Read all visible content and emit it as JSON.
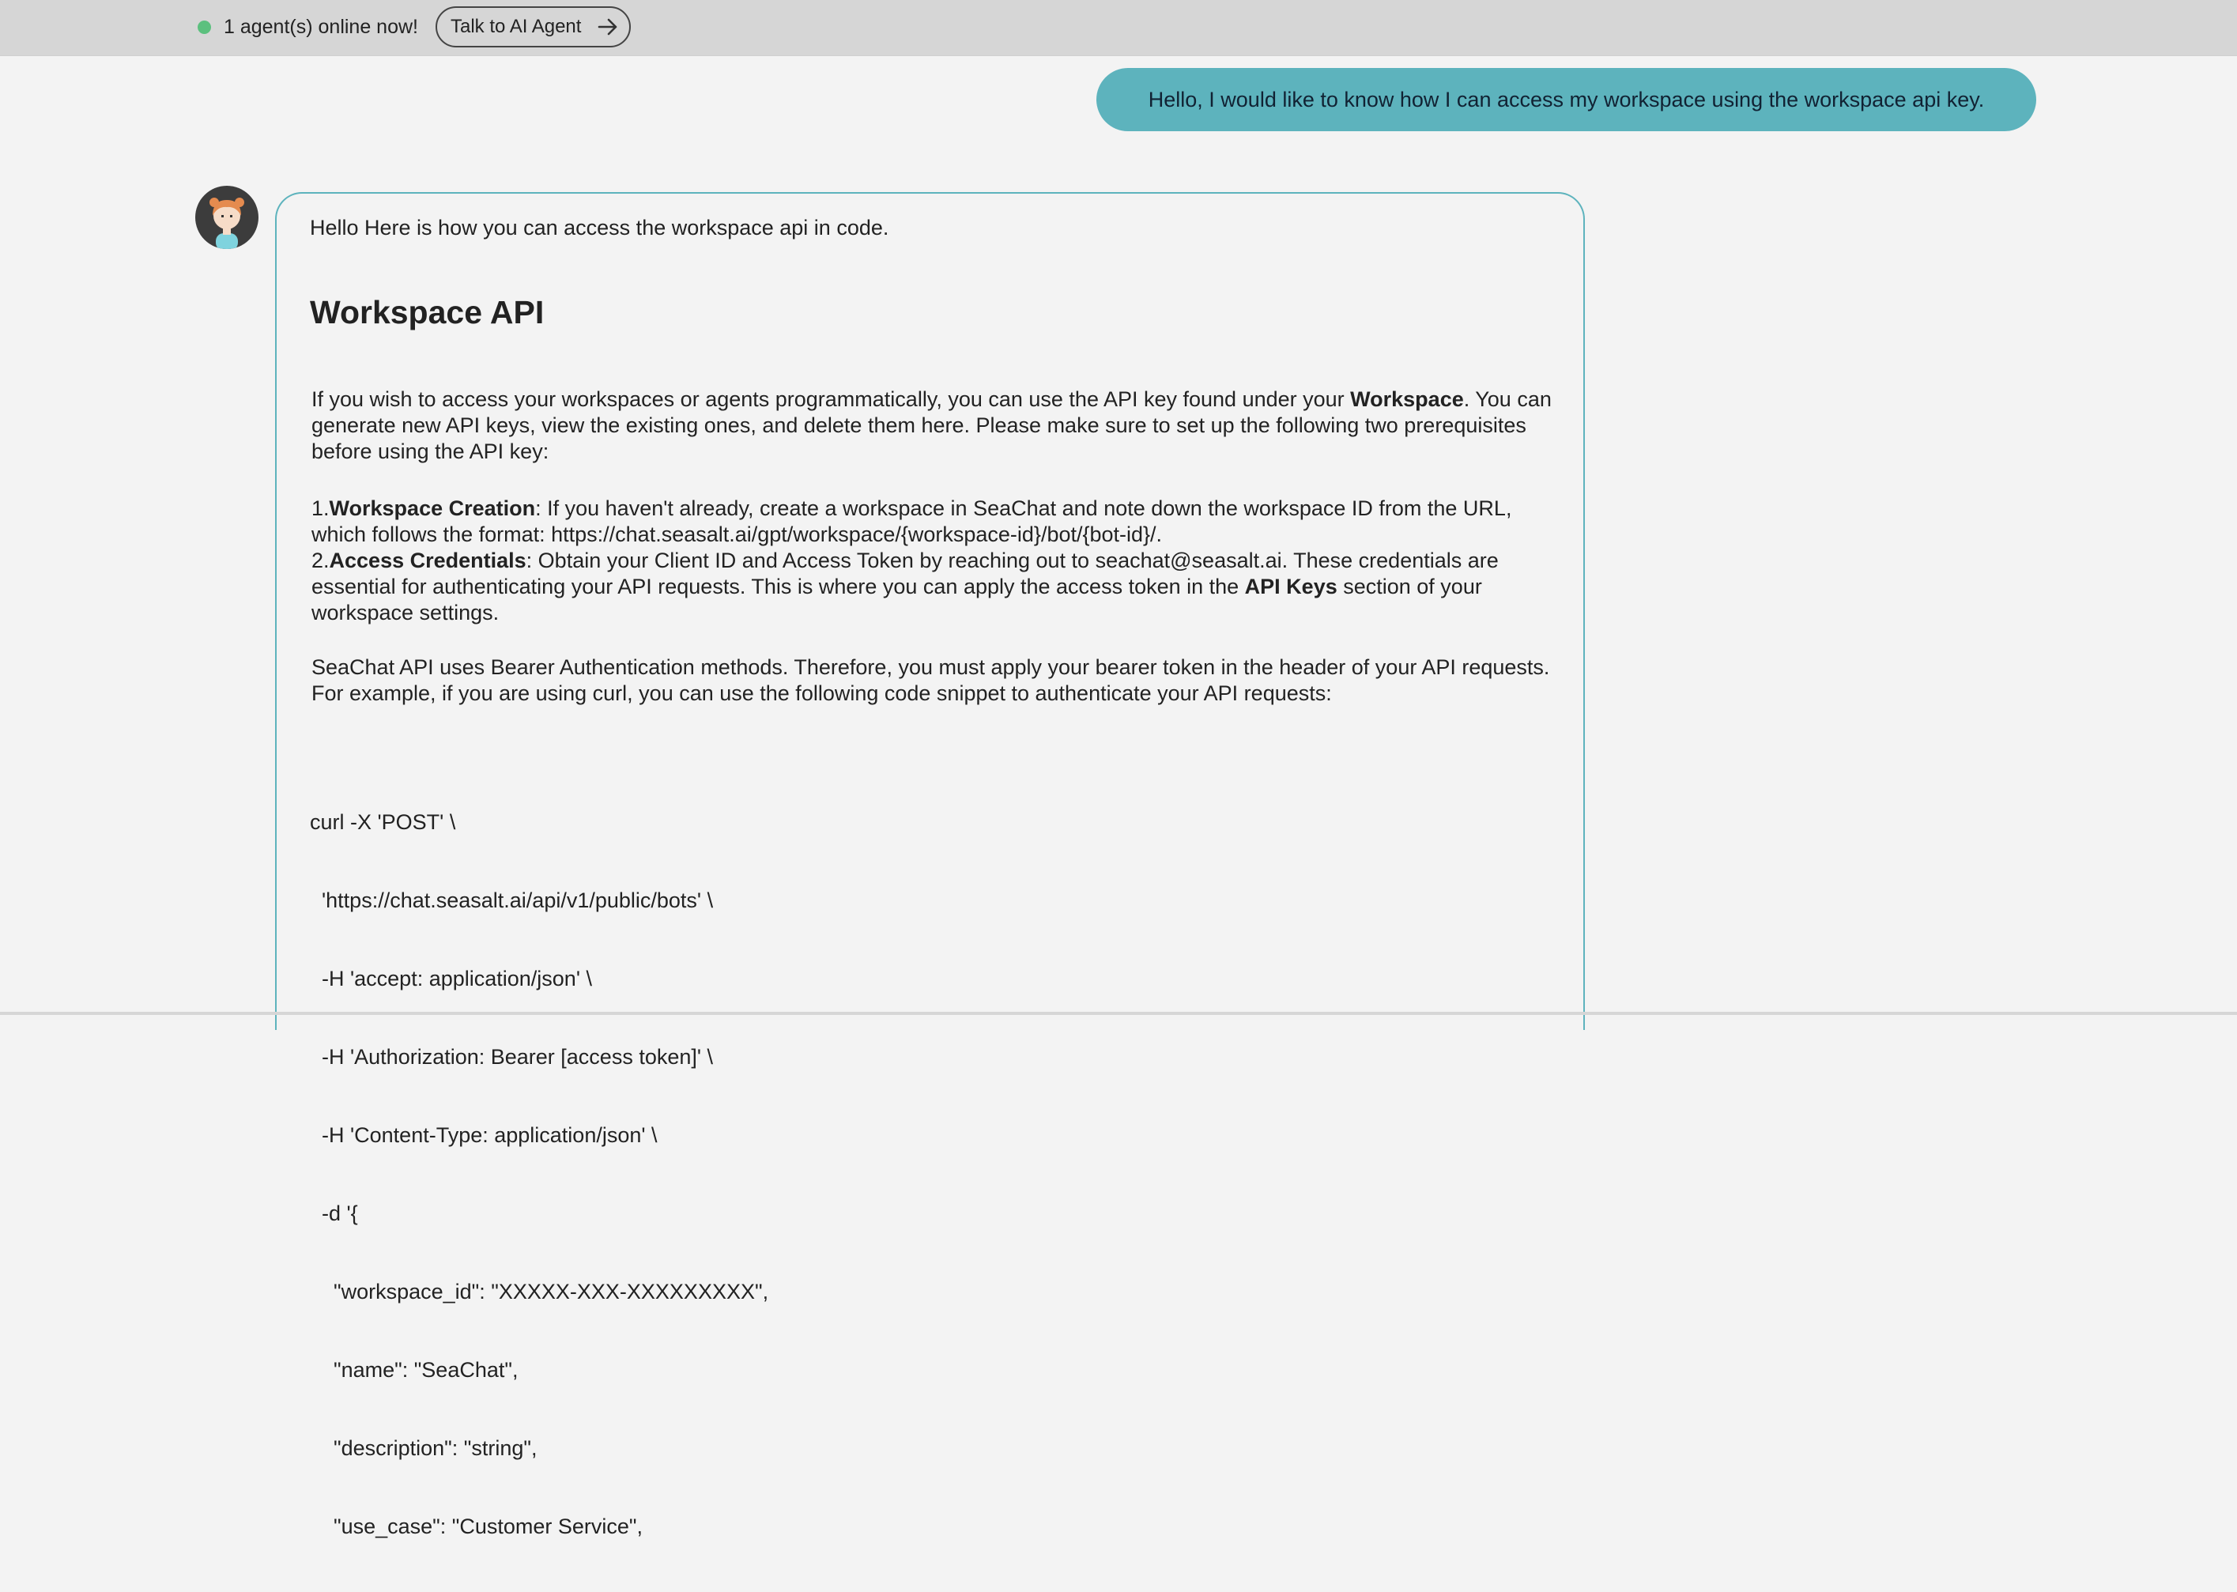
{
  "header": {
    "online_status": "1 agent(s) online now!",
    "talk_button_label": "Talk to AI Agent"
  },
  "colors": {
    "accent": "#5db3bd",
    "online": "#5cc07e",
    "topbar": "#d6d6d6",
    "background": "#f3f3f3"
  },
  "user_message": "Hello, I would like to know how I can access my workspace using the workspace api key.",
  "bot_message": {
    "intro": "Hello Here is how you can access the workspace api in code.",
    "heading": "Workspace API",
    "p1_a": "If you wish to access your workspaces or agents programmatically, you can use the API key found under your ",
    "p1_b": "Workspace",
    "p1_c": ". You can generate new API keys, view the existing ones, and delete them here. Please make sure to set up the following two prerequisites before using the API key:",
    "item1_num": "1.",
    "item1_bold": "Workspace Creation",
    "item1_text": ": If you haven't already, create a workspace in SeaChat and note down the workspace ID from the URL, which follows the format: https://chat.seasalt.ai/gpt/workspace/{workspace-id}/bot/{bot-id}/.",
    "item2_num": "2.",
    "item2_bold": "Access Credentials",
    "item2_text_a": ": Obtain your Client ID and Access Token by reaching out to seachat@seasalt.ai. These credentials are essential for authenticating your API requests. This is where you can apply the access token in the ",
    "item2_bold2": "API Keys",
    "item2_text_b": " section of your workspace settings.",
    "p3": "SeaChat API uses Bearer Authentication methods. Therefore, you must apply your bearer token in the header of your API requests. For example, if you are using curl, you can use the following code snippet to authenticate your API requests:",
    "code_lines": [
      "curl -X 'POST' \\",
      "  'https://chat.seasalt.ai/api/v1/public/bots' \\",
      "  -H 'accept: application/json' \\",
      "  -H 'Authorization: Bearer [access token]' \\",
      "  -H 'Content-Type: application/json' \\",
      "  -d '{",
      "    \"workspace_id\": \"XXXXX-XXX-XXXXXXXXX\",",
      "    \"name\": \"SeaChat\",",
      "    \"description\": \"string\",",
      "    \"use_case\": \"Customer Service\","
    ]
  }
}
